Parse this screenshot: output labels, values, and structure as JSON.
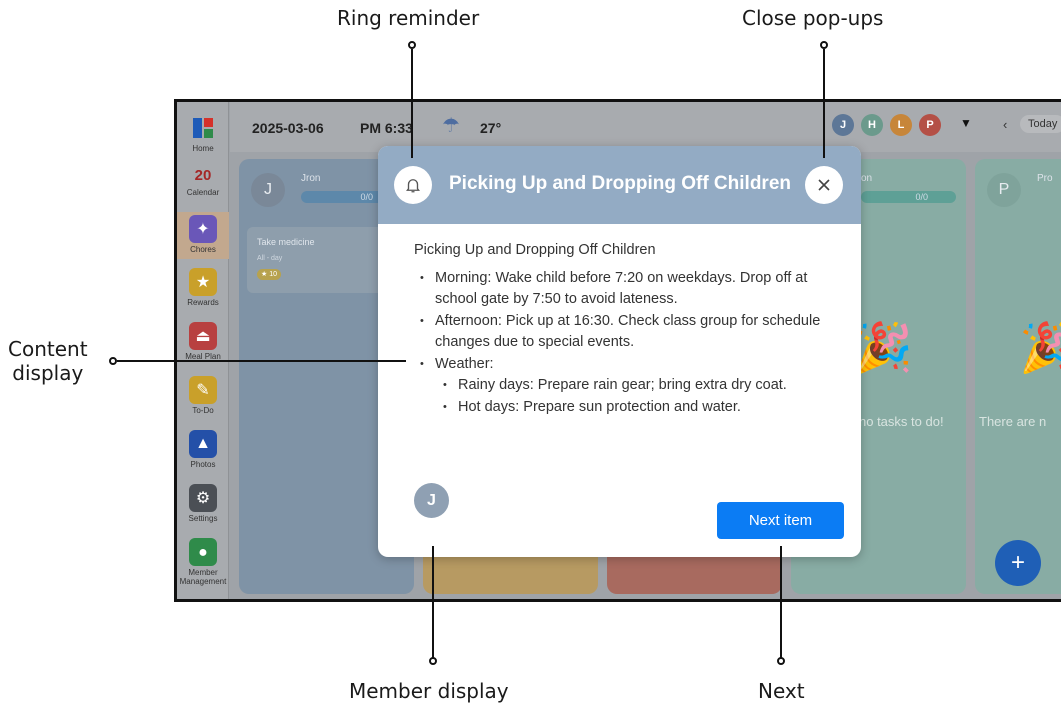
{
  "annotations": {
    "ring_reminder": "Ring reminder",
    "close_popups": "Close pop-ups",
    "content_display_line1": "Content",
    "content_display_line2": "display",
    "member_display": "Member display",
    "next": "Next"
  },
  "sidebar": {
    "items": [
      {
        "label": "Home",
        "icon": "home-icon",
        "color": "#1e5bb8"
      },
      {
        "label": "Calendar",
        "icon": "calendar-icon",
        "number": "20",
        "color": "#b02020"
      },
      {
        "label": "Chores",
        "icon": "chores-icon",
        "color": "#6a57b8"
      },
      {
        "label": "Rewards",
        "icon": "star-icon",
        "color": "#c9a02a"
      },
      {
        "label": "Meal Plan",
        "icon": "meal-plan-icon",
        "color": "#b84040"
      },
      {
        "label": "To-Do",
        "icon": "pencil-icon",
        "color": "#c9a02a"
      },
      {
        "label": "Photos",
        "icon": "photos-icon",
        "color": "#2450a8"
      },
      {
        "label": "Settings",
        "icon": "gear-icon",
        "color": "#4b4f55"
      },
      {
        "label": "Member Management",
        "icon": "member-icon",
        "color": "#2f8b4a"
      }
    ]
  },
  "topbar": {
    "date": "2025-03-06",
    "time": "PM 6:33",
    "weather_icon": "rain-cloud-icon",
    "temperature": "27°",
    "members": [
      {
        "initial": "J",
        "color": "#5d7797"
      },
      {
        "initial": "H",
        "color": "#6b9a8c"
      },
      {
        "initial": "L",
        "color": "#c7863a"
      },
      {
        "initial": "P",
        "color": "#b45046"
      }
    ],
    "today_label": "Today"
  },
  "columns": [
    {
      "initial": "J",
      "name": "Jron",
      "progress": "0/0",
      "color": "#7f93a6"
    },
    {
      "color": "#b79a62"
    },
    {
      "color": "#a86a5f"
    },
    {
      "name": "on",
      "progress": "0/0",
      "color": "#88aca4",
      "empty_text": "no tasks to do!"
    },
    {
      "initial": "P",
      "name": "Pro",
      "color": "#88aca4",
      "empty_text": "There are n"
    }
  ],
  "task": {
    "title": "Take medicine",
    "subtitle": "All - day",
    "points": "10"
  },
  "modal": {
    "title": "Picking Up and Dropping Off Children",
    "lead": "Picking Up and Dropping Off Children",
    "items": [
      "Morning: Wake child before 7:20 on weekdays. Drop off at school gate by 7:50 to avoid lateness.",
      "Afternoon: Pick up at 16:30. Check class group for schedule changes due to special events.",
      "Weather:"
    ],
    "sub_items": [
      "Rainy days: Prepare rain gear; bring extra dry coat.",
      "Hot days: Prepare sun protection and water."
    ],
    "member_initial": "J",
    "next_label": "Next item"
  },
  "fab_label": "+"
}
